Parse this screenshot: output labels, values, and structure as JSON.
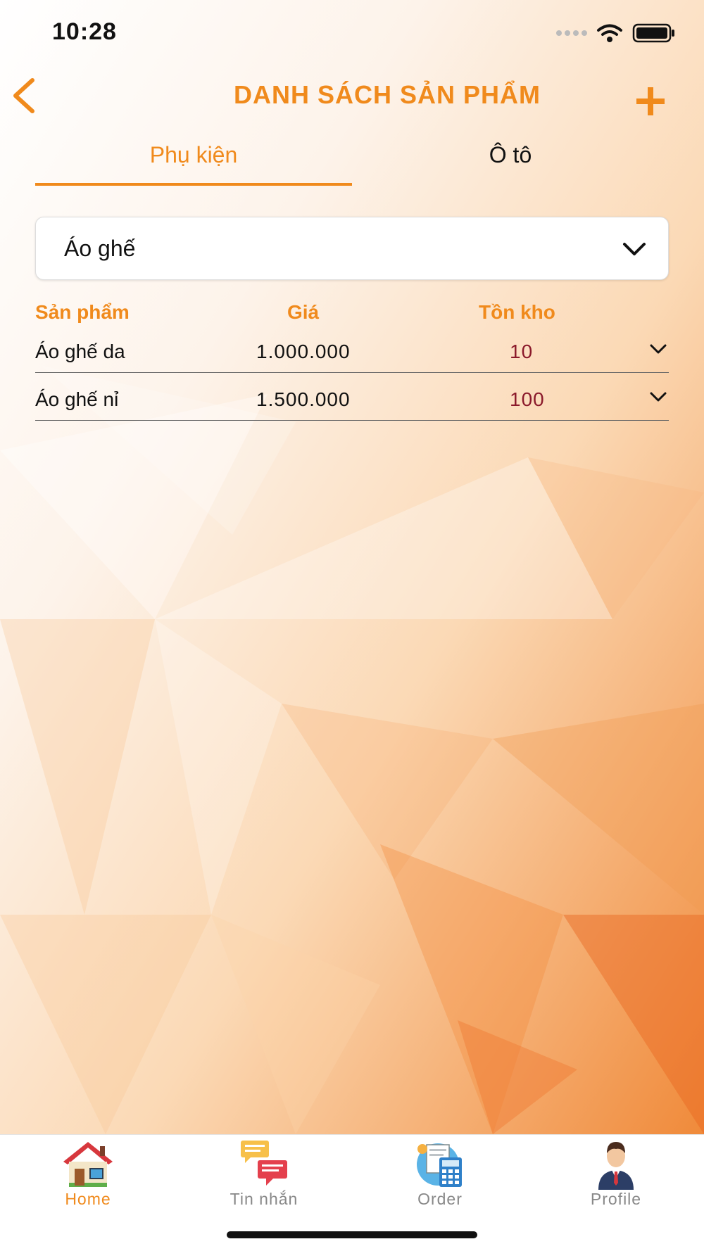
{
  "status_bar": {
    "time": "10:28"
  },
  "header": {
    "title": "DANH SÁCH SẢN PHẨM"
  },
  "tabs": [
    {
      "label": "Phụ kiện",
      "active": true
    },
    {
      "label": "Ô tô",
      "active": false
    }
  ],
  "category_select": {
    "value": "Áo ghế"
  },
  "table": {
    "columns": [
      "Sản phẩm",
      "Giá",
      "Tồn kho"
    ],
    "rows": [
      {
        "name": "Áo ghế da",
        "price": "1.000.000",
        "stock": "10"
      },
      {
        "name": "Áo ghế nỉ",
        "price": "1.500.000",
        "stock": "100"
      }
    ]
  },
  "bottom_nav": {
    "items": [
      {
        "label": "Home",
        "icon": "house-icon",
        "active": true
      },
      {
        "label": "Tin nhắn",
        "icon": "chat-bubbles-icon",
        "active": false
      },
      {
        "label": "Order",
        "icon": "calculator-icon",
        "active": false
      },
      {
        "label": "Profile",
        "icon": "businessman-icon",
        "active": false
      }
    ]
  },
  "colors": {
    "accent": "#F08A1C",
    "stock_text": "#8B1A2B",
    "inactive_nav": "#888888"
  }
}
